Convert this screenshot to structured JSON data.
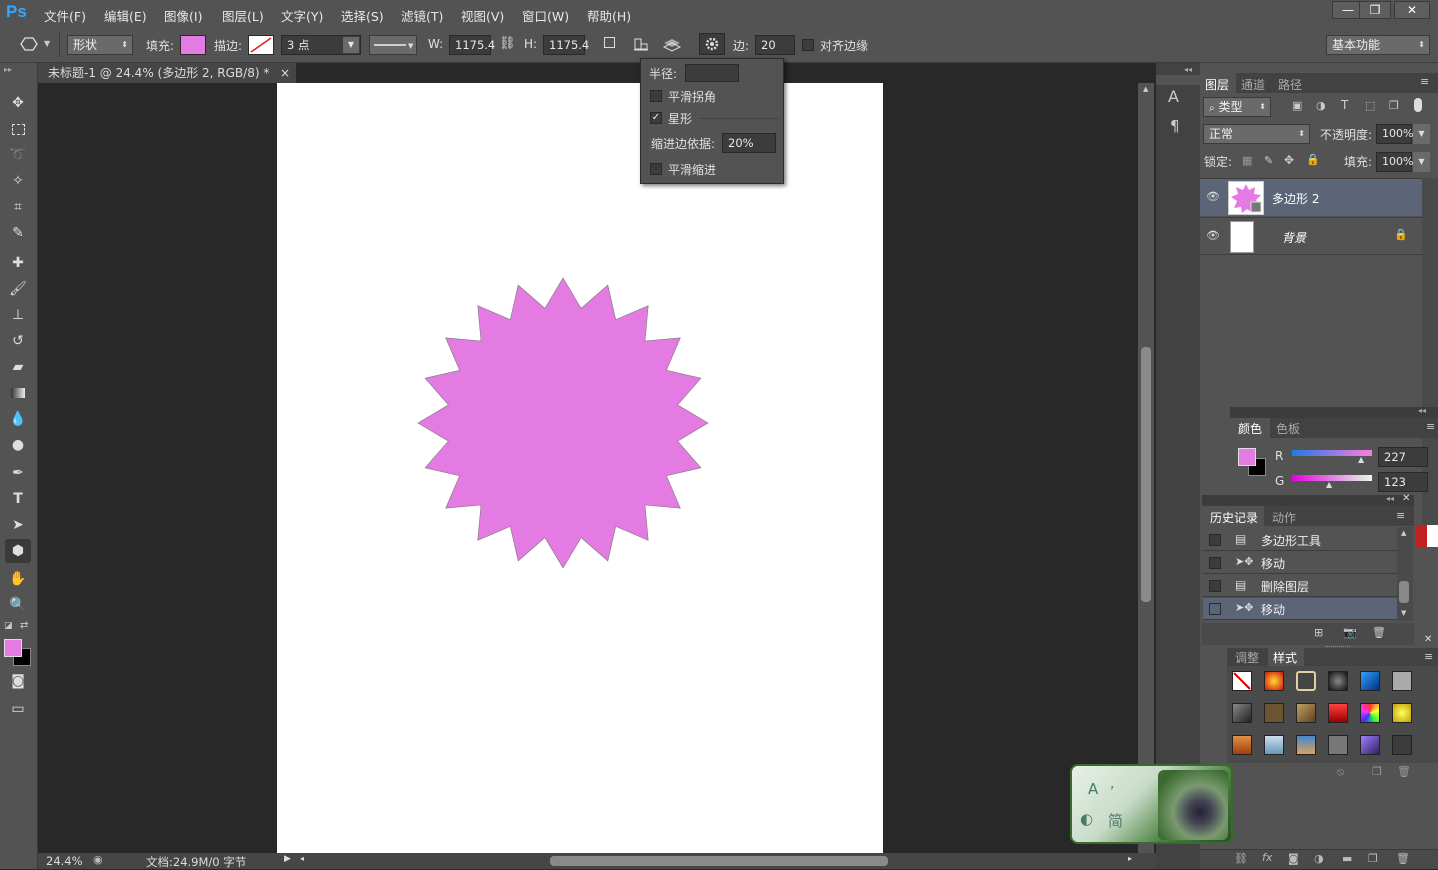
{
  "app": {
    "logo": "Ps",
    "menu": [
      "文件(F)",
      "编辑(E)",
      "图像(I)",
      "图层(L)",
      "文字(Y)",
      "选择(S)",
      "滤镜(T)",
      "视图(V)",
      "窗口(W)",
      "帮助(H)"
    ],
    "window_buttons": [
      "—",
      "❐",
      "✕"
    ]
  },
  "options": {
    "mode": "形状",
    "fill_label": "填充:",
    "fill_color": "#e37be2",
    "stroke_label": "描边:",
    "stroke_width": "3 点",
    "w_label": "W:",
    "w_value": "1175.4",
    "h_label": "H:",
    "h_value": "1175.4",
    "sides_label": "边:",
    "sides_value": "20",
    "align_edges": "对齐边缘",
    "workspace": "基本功能"
  },
  "polygon_options": {
    "radius_label": "半径:",
    "radius_value": "",
    "smooth_corners": "平滑拐角",
    "smooth_corners_checked": false,
    "star": "星形",
    "star_checked": true,
    "indent_label": "缩进边依据:",
    "indent_value": "20%",
    "smooth_indents": "平滑缩进",
    "smooth_indents_checked": false
  },
  "document": {
    "tab_title": "未标题-1 @ 24.4% (多边形 2, RGB/8) *",
    "close": "×",
    "zoom": "24.4%",
    "doc_size": "文档:24.9M/0 字节",
    "star_points": 20,
    "star_inner_ratio": 0.8,
    "star_color": "#e37be2"
  },
  "layers_panel": {
    "tabs": [
      "图层",
      "通道",
      "路径"
    ],
    "filter_kind": "类型",
    "blend_mode": "正常",
    "opacity_label": "不透明度:",
    "opacity": "100%",
    "lock_label": "锁定:",
    "fill_label": "填充:",
    "fill": "100%",
    "layers": [
      {
        "name": "多边形 2",
        "selected": true
      },
      {
        "name": "背景",
        "selected": false
      }
    ]
  },
  "color_panel": {
    "tabs": [
      "颜色",
      "色板"
    ],
    "r_label": "R",
    "r_value": "227",
    "g_label": "G",
    "g_value": "123",
    "fg_color": "#e37be2",
    "bg_color": "#000000"
  },
  "history_panel": {
    "tabs": [
      "历史记录",
      "动作"
    ],
    "items": [
      "多边形工具",
      "移动",
      "删除图层",
      "移动"
    ],
    "selected_index": 3
  },
  "styles_panel": {
    "tabs": [
      "调整",
      "样式"
    ]
  },
  "ime_widget": {
    "label_a": "A",
    "label_jian": "简"
  }
}
